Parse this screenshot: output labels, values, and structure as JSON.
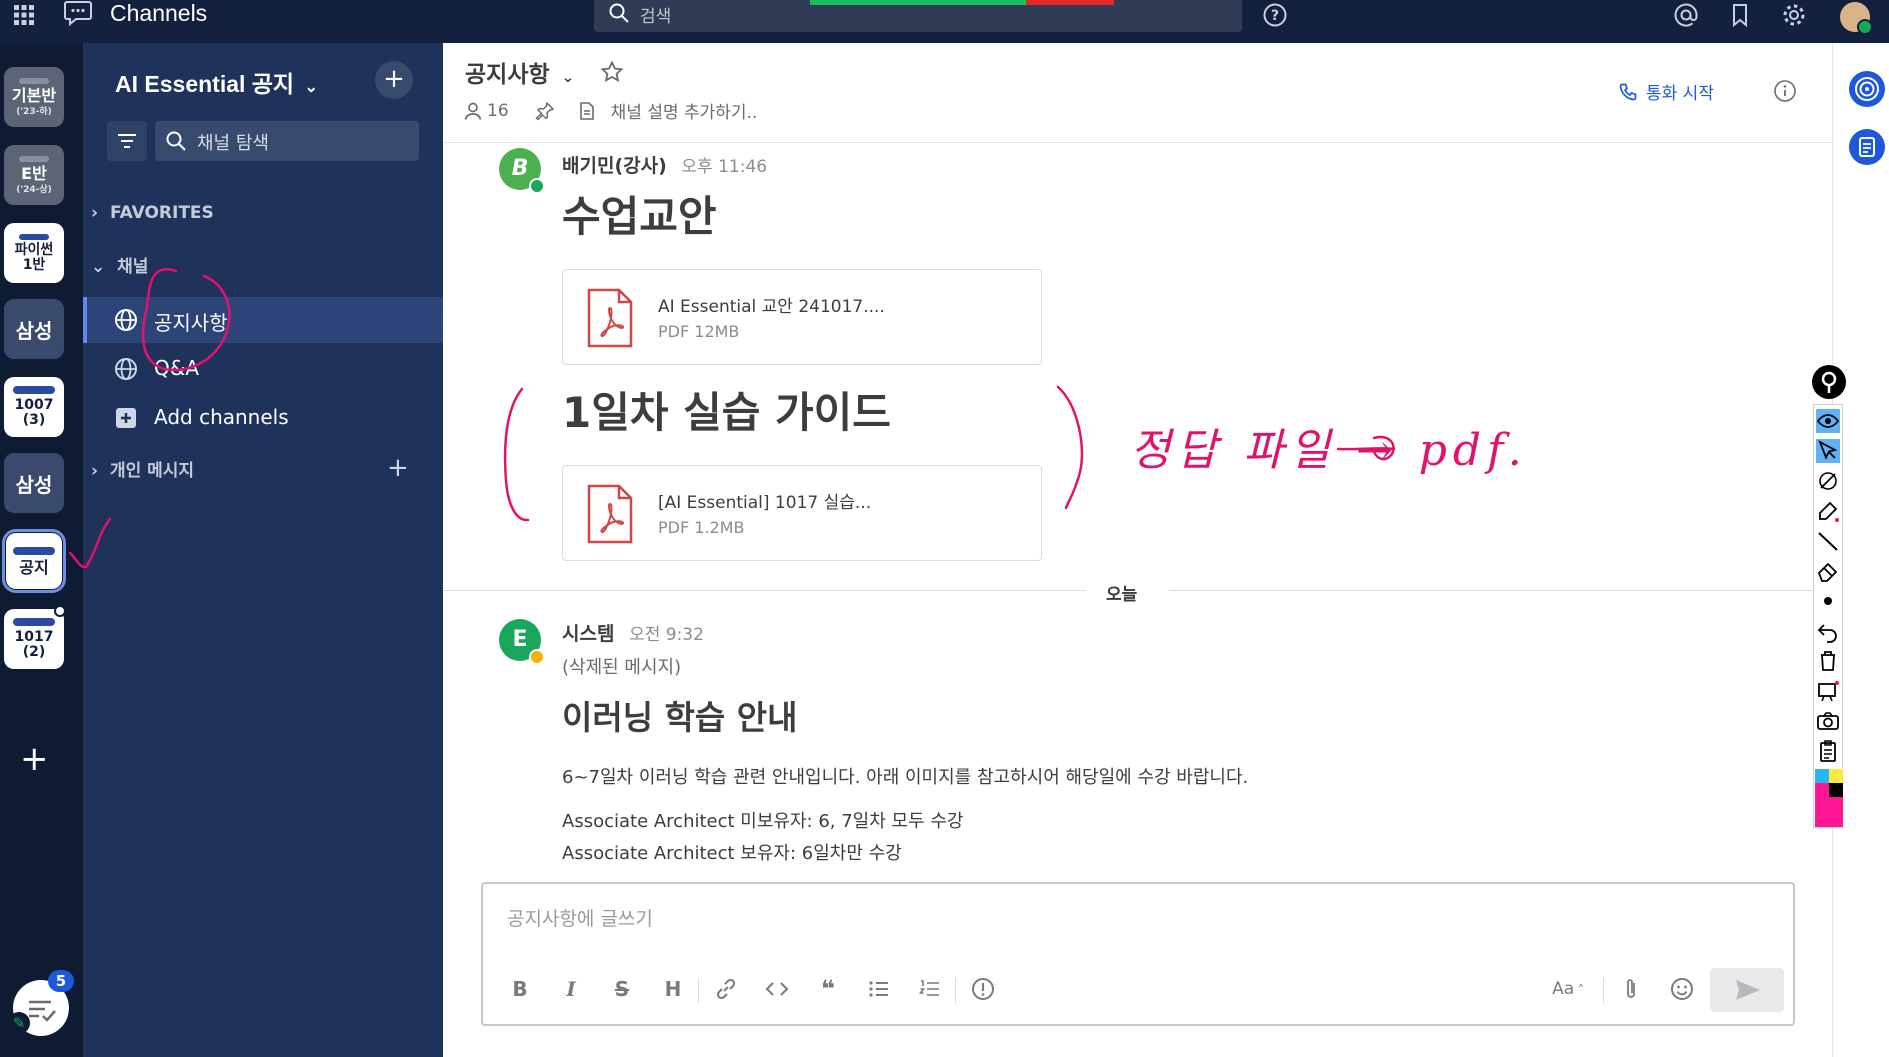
{
  "app": {
    "title": "Channels",
    "search_placeholder": "검색"
  },
  "teams": [
    {
      "line1": "기본반",
      "line2": "('23-하)",
      "style": "grey"
    },
    {
      "line1": "E반",
      "line2": "('24-상)",
      "style": "grey"
    },
    {
      "line1": "파이썬",
      "line2": "1반",
      "style": "white"
    },
    {
      "line1": "삼성",
      "line2": "",
      "style": "dark"
    },
    {
      "line1": "1007",
      "line2": "(3)",
      "style": "white"
    },
    {
      "line1": "삼성",
      "line2": "",
      "style": "dark"
    },
    {
      "line1": "공지",
      "line2": "",
      "style": "white-active"
    },
    {
      "line1": "1017",
      "line2": "(2)",
      "style": "white"
    }
  ],
  "mentions_badge": "5",
  "sidebar": {
    "team_name": "AI Essential 공지",
    "search_placeholder": "채널 탐색",
    "favorites_label": "FAVORITES",
    "channels_label": "채널",
    "channels": [
      {
        "label": "공지사항",
        "icon": "globe-icon",
        "active": true
      },
      {
        "label": "Q&A",
        "icon": "globe-icon",
        "active": false
      }
    ],
    "add_channels_label": "Add channels",
    "dm_label": "개인 메시지"
  },
  "channel": {
    "name": "공지사항",
    "member_count": "16",
    "description_placeholder": "채널 설명 추가하기..",
    "call_label": "통화 시작"
  },
  "messages": [
    {
      "author": "배기민(강사)",
      "time": "오후 11:46",
      "avatar_letter": "B",
      "avatar_color": "#4caf50",
      "blocks": [
        {
          "heading": "수업교안",
          "file_name": "AI Essential 교안 241017....",
          "file_meta": "PDF 12MB"
        },
        {
          "heading": "1일차 실습 가이드",
          "file_name": "[AI Essential] 1017 실습...",
          "file_meta": "PDF 1.2MB"
        }
      ]
    },
    {
      "author": "시스템",
      "time": "오전 9:32",
      "avatar_letter": "E",
      "avatar_color": "#1aa75d",
      "deleted_note": "(삭제된 메시지)",
      "heading": "이러닝 학습 안내",
      "paragraphs": [
        "6~7일차 이러닝 학습 관련 안내입니다. 아래 이미지를 참고하시어 해당일에 수강 바랍니다.",
        "Associate Architect 미보유자: 6, 7일차 모두 수강",
        "Associate Architect 보유자: 6일차만 수강"
      ]
    }
  ],
  "date_separator": "오늘",
  "composer": {
    "placeholder": "공지사항에 글쓰기",
    "format_label": "Aa"
  },
  "handwriting_note": "정답 파일 → pdf.",
  "colors": {
    "topbar": "#14213e",
    "sidebar": "#1e325c",
    "accent": "#1c58d9",
    "annotation_ink": "#e0136c"
  }
}
